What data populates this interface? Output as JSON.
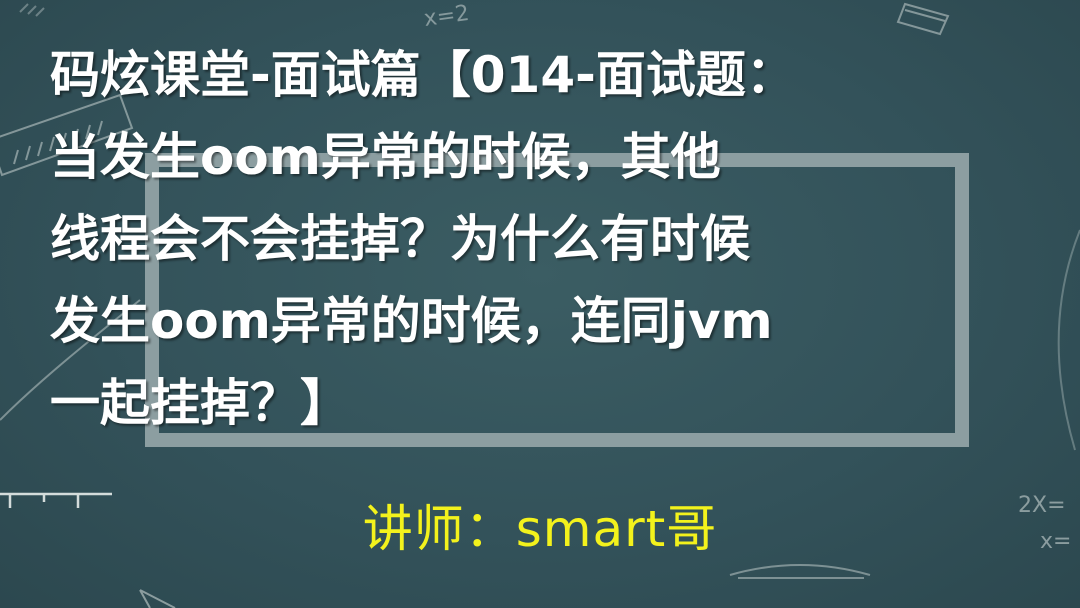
{
  "title_lines": [
    "码炫课堂-面试篇【014-面试题：",
    "当发生oom异常的时候，其他",
    "线程会不会挂掉？为什么有时候",
    "发生oom异常的时候，连同jvm",
    "一起挂掉？】"
  ],
  "lecturer": {
    "label": "讲师：",
    "name": "smart哥"
  },
  "doodles": {
    "top_formula": "x=2",
    "right_formula_1": "2X=",
    "right_formula_2": "x="
  },
  "colors": {
    "board": "#34545a",
    "frame": "#8c9ea1",
    "title_text": "#ffffff",
    "lecturer_text": "#f3f21c",
    "chalk": "#c9d3d2"
  }
}
